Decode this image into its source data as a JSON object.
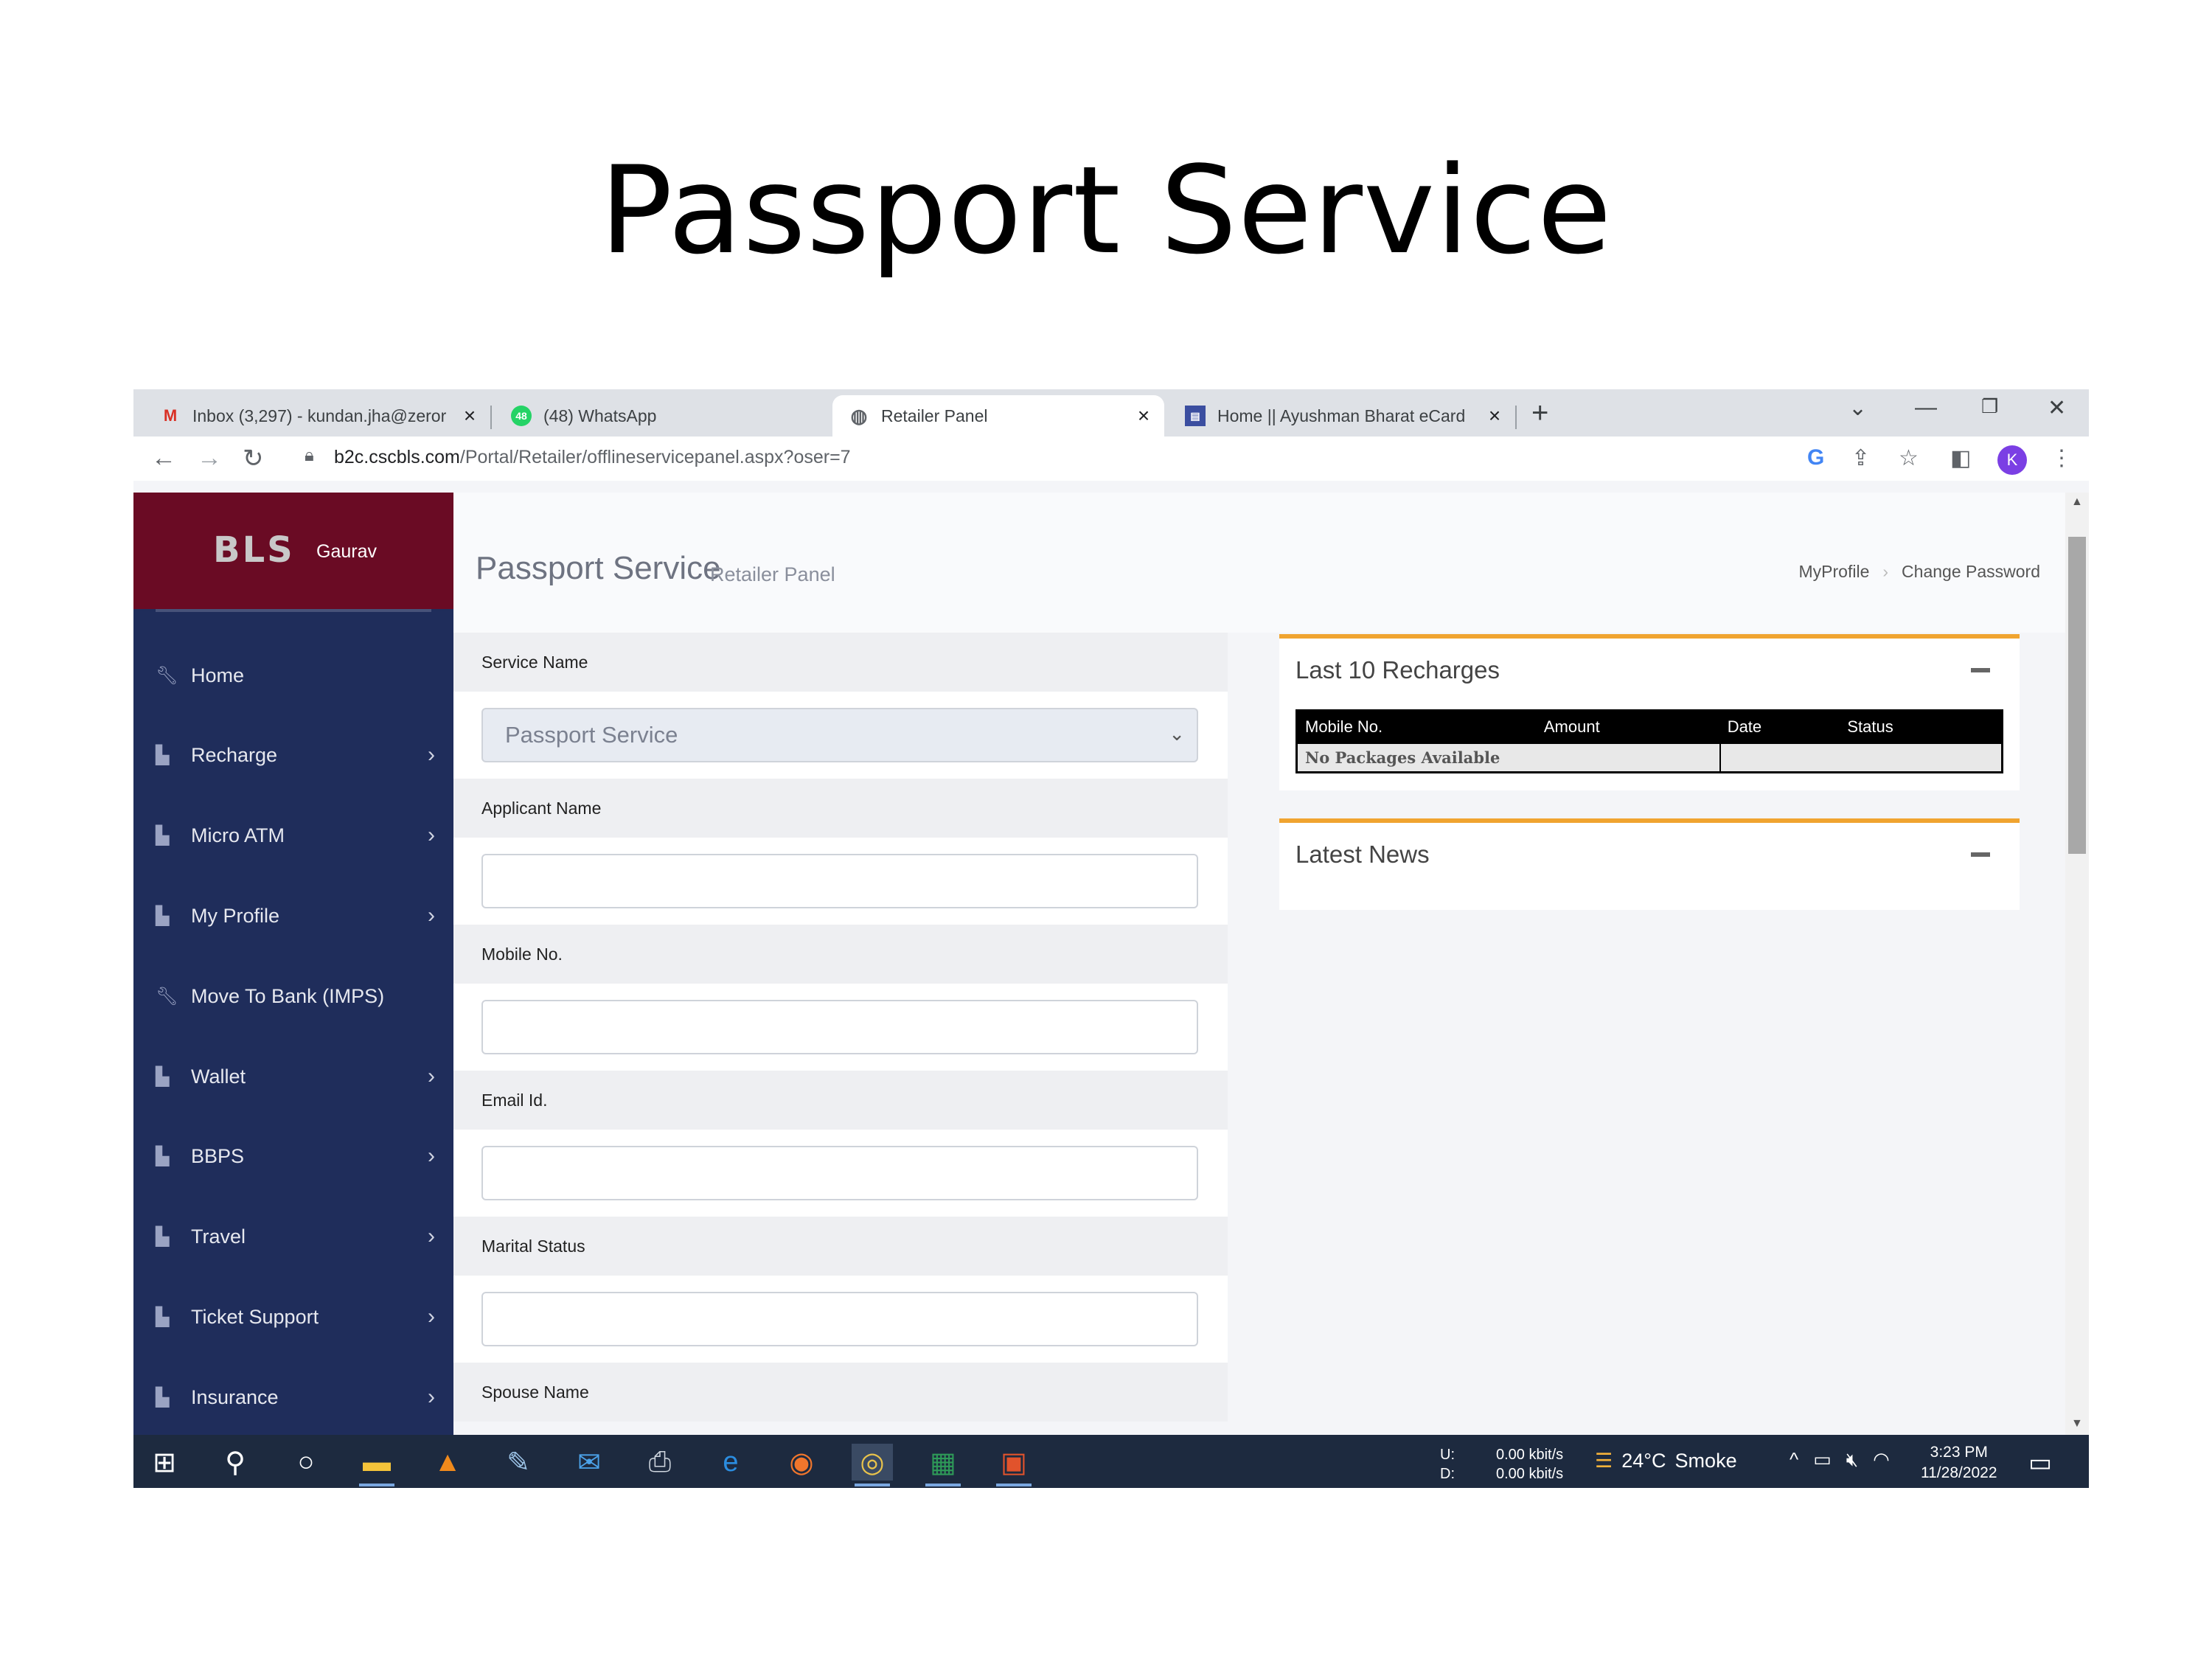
{
  "slide": {
    "title": "Passport Service"
  },
  "browser": {
    "tabs": [
      {
        "label": "Inbox (3,297) - kundan.jha@zeror",
        "favicon": "gmail-icon",
        "active": false
      },
      {
        "label": "(48) WhatsApp",
        "favicon": "whatsapp-icon",
        "active": false
      },
      {
        "label": "Retailer Panel",
        "favicon": "globe-icon",
        "active": true
      },
      {
        "label": "Home || Ayushman Bharat eCard",
        "favicon": "site-icon",
        "active": false
      }
    ],
    "url_host": "b2c.cscbls.com",
    "url_path": "/Portal/Retailer/offlineservicepanel.aspx?oser=7",
    "profile_initial": "K"
  },
  "sidebar": {
    "logo": "BLS",
    "user": "Gaurav",
    "items": [
      {
        "label": "Home",
        "icon": "wrench-icon",
        "has_submenu": false
      },
      {
        "label": "Recharge",
        "icon": "chart-icon",
        "has_submenu": true
      },
      {
        "label": "Micro ATM",
        "icon": "chart-icon",
        "has_submenu": true
      },
      {
        "label": "My Profile",
        "icon": "chart-icon",
        "has_submenu": true
      },
      {
        "label": "Move To Bank (IMPS)",
        "icon": "wrench-icon",
        "has_submenu": false
      },
      {
        "label": "Wallet",
        "icon": "chart-icon",
        "has_submenu": true
      },
      {
        "label": "BBPS",
        "icon": "chart-icon",
        "has_submenu": true
      },
      {
        "label": "Travel",
        "icon": "chart-icon",
        "has_submenu": true
      },
      {
        "label": "Ticket Support",
        "icon": "chart-icon",
        "has_submenu": true
      },
      {
        "label": "Insurance",
        "icon": "chart-icon",
        "has_submenu": true
      }
    ]
  },
  "header": {
    "title": "Passport Service",
    "subtitle": "Retailer Panel",
    "links": [
      "MyProfile",
      "Change Password"
    ]
  },
  "form": {
    "service_name_label": "Service Name",
    "service_name_value": "Passport Service",
    "applicant_name_label": "Applicant Name",
    "mobile_label": "Mobile No.",
    "email_label": "Email Id.",
    "marital_status_label": "Marital Status",
    "spouse_name_label": "Spouse Name"
  },
  "recharges_panel": {
    "title": "Last 10 Recharges",
    "columns": [
      "Mobile No.",
      "Amount",
      "Date",
      "Status"
    ],
    "empty_text": "No Packages Available"
  },
  "news_panel": {
    "title": "Latest News"
  },
  "taskbar": {
    "net_labels": [
      "U:",
      "D:"
    ],
    "net_values": [
      "0.00 kbit/s",
      "0.00 kbit/s"
    ],
    "weather_temp": "24°C",
    "weather_text": "Smoke",
    "time": "3:23 PM",
    "date": "11/28/2022"
  },
  "colors": {
    "sidebar_bg": "#1f2d5b",
    "brand_bg": "#6a0b24",
    "panel_accent": "#f0a430"
  }
}
